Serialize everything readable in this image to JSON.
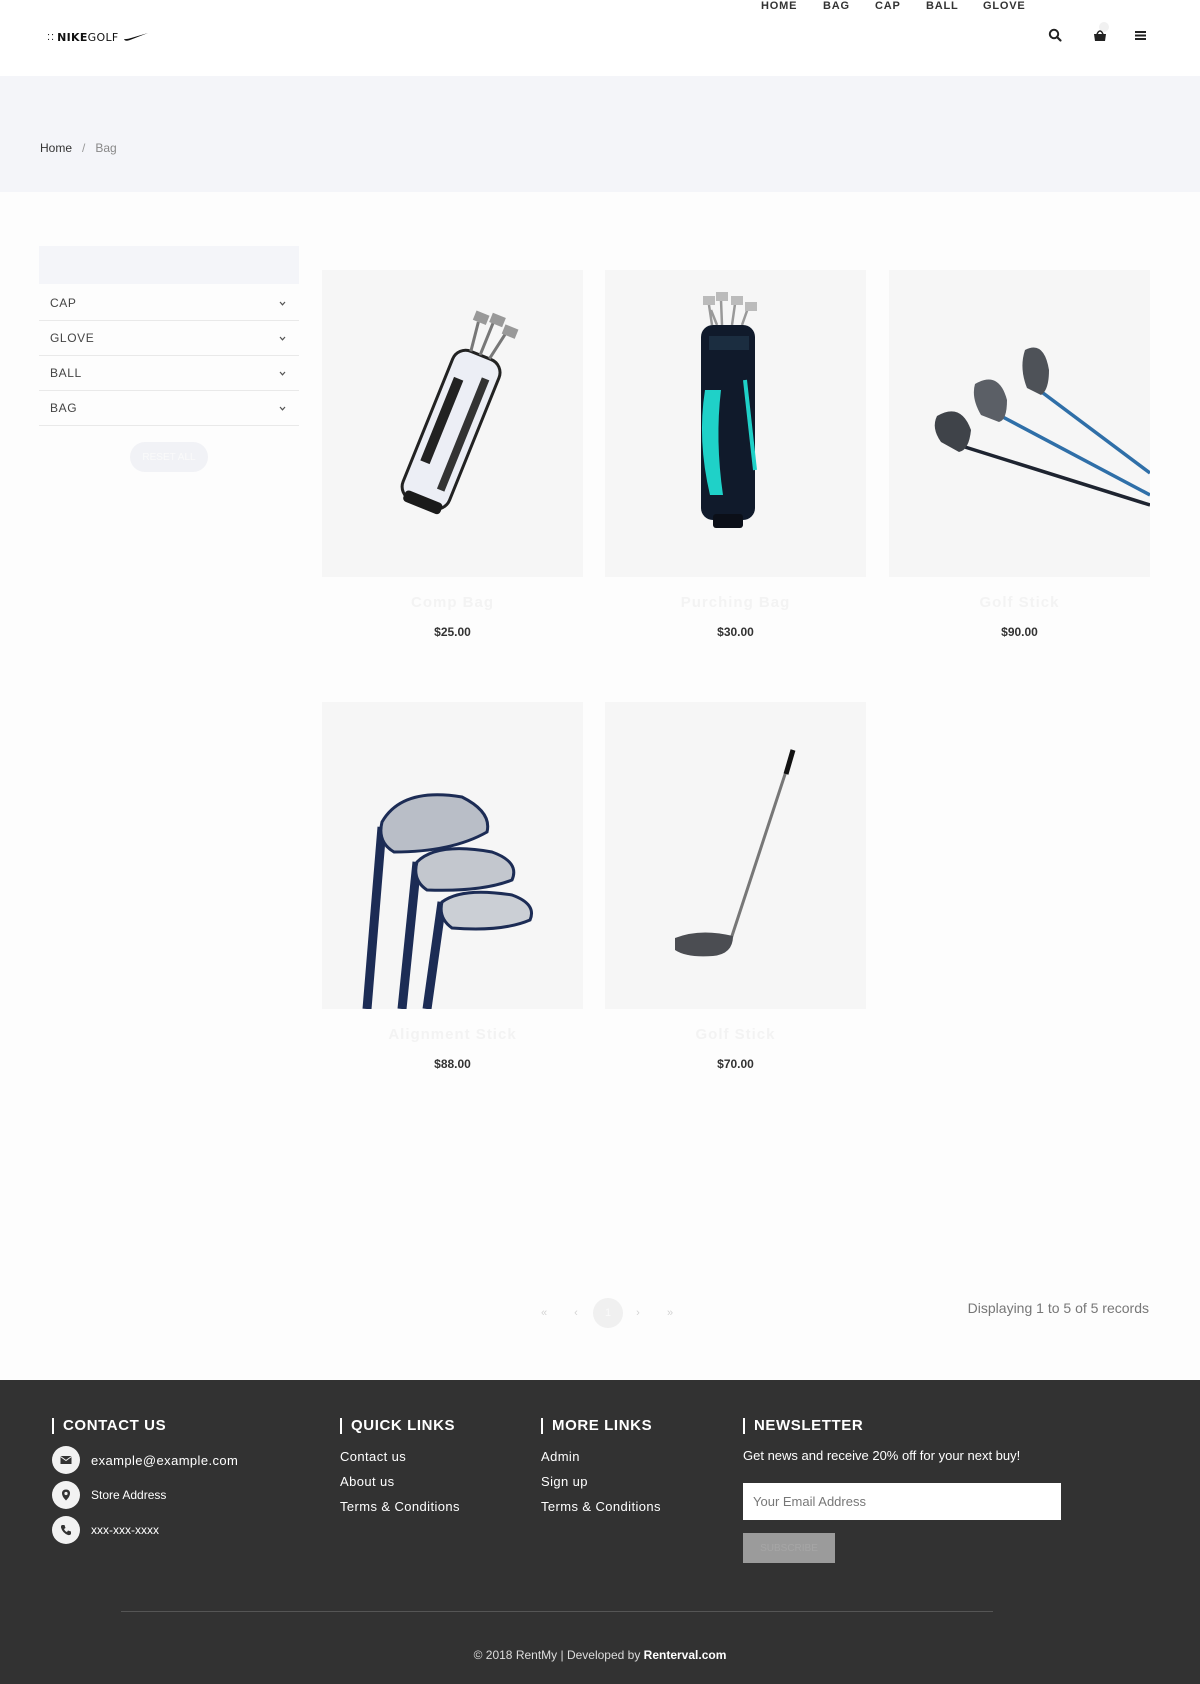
{
  "brand": {
    "logo_dots": "::",
    "logo_bold": "NIKE",
    "logo_light": "GOLF"
  },
  "nav": {
    "items": [
      "HOME",
      "BAG",
      "CAP",
      "BALL",
      "GLOVE"
    ],
    "icons": [
      "search-icon",
      "cart-icon",
      "menu-icon"
    ]
  },
  "breadcrumb": {
    "home": "Home",
    "separator": "/",
    "current": "Bag"
  },
  "sidebar": {
    "categories": [
      "CAP",
      "GLOVE",
      "BALL",
      "BAG"
    ],
    "reset_label": "RESET ALL"
  },
  "products": [
    {
      "name": "Comp Bag",
      "price": "$25.00"
    },
    {
      "name": "Purching Bag",
      "price": "$30.00"
    },
    {
      "name": "Golf Stick",
      "price": "$90.00"
    },
    {
      "name": "Alignment Stick",
      "price": "$88.00"
    },
    {
      "name": "Golf Stick",
      "price": "$70.00"
    }
  ],
  "pagination": {
    "first": "«",
    "prev": "‹",
    "current": "1",
    "next": "›",
    "last": "»",
    "records": "Displaying 1 to 5 of 5 records"
  },
  "footer": {
    "contact": {
      "heading": "CONTACT US",
      "email": "example@example.com",
      "address": "Store Address",
      "phone": "xxx-xxx-xxxx"
    },
    "quick_links": {
      "heading": "QUICK LINKS",
      "items": [
        "Contact us",
        "About us",
        "Terms & Conditions"
      ]
    },
    "more_links": {
      "heading": "MORE LINKS",
      "items": [
        "Admin",
        "Sign up",
        "Terms & Conditions"
      ]
    },
    "newsletter": {
      "heading": "NEWSLETTER",
      "text": "Get news and receive 20% off for your next buy!",
      "placeholder": "Your Email Address",
      "button": "SUBSCRIBE"
    },
    "copyright_prefix": "© 2018 RentMy | Developed by",
    "copyright_brand": "Renterval.com"
  },
  "colors": {
    "footer_bg": "#323232",
    "band_bg": "#f4f5f9",
    "accent_teal": "#1fd1c8"
  }
}
